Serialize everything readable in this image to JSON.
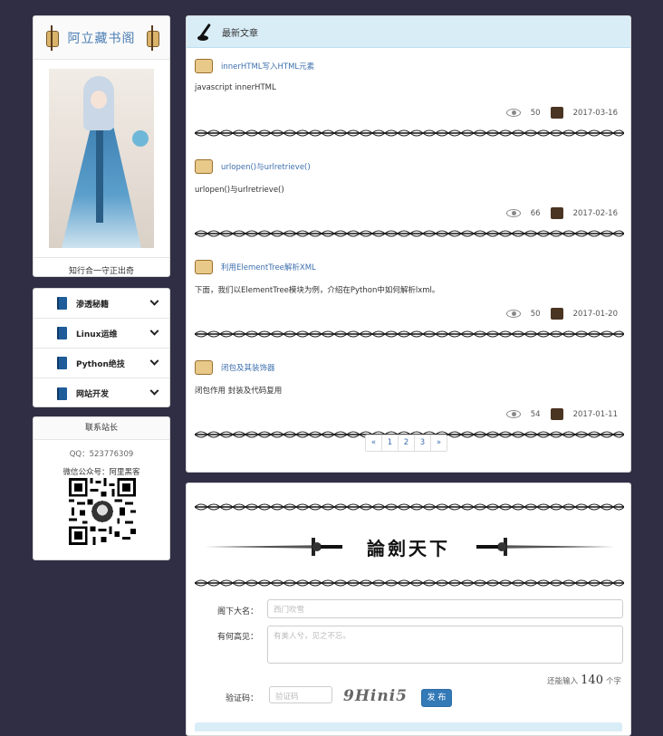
{
  "brand": {
    "title": "阿立藏书阁",
    "motto": "知行合一守正出奇"
  },
  "menu": {
    "items": [
      {
        "label": "渗透秘籍"
      },
      {
        "label": "Linux运维"
      },
      {
        "label": "Python绝技"
      },
      {
        "label": "网站开发"
      }
    ]
  },
  "contact": {
    "title": "联系站长",
    "qq": "QQ：523776309",
    "wechat": "微信公众号：阿里黑客"
  },
  "articles": {
    "title": "最新文章",
    "items": [
      {
        "title": "innerHTML写入HTML元素",
        "summary": "javascript innerHTML",
        "views": "50",
        "date": "2017-03-16"
      },
      {
        "title": "urlopen()与urlretrieve()",
        "summary": "urlopen()与urlretrieve()",
        "views": "66",
        "date": "2017-02-16"
      },
      {
        "title": "利用ElementTree解析XML",
        "summary": "下面，我们以ElementTree模块为例，介绍在Python中如何解析lxml。",
        "views": "50",
        "date": "2017-01-20"
      },
      {
        "title": "闭包及其装饰器",
        "summary": "闭包作用 封装及代码复用",
        "views": "54",
        "date": "2017-01-11"
      }
    ]
  },
  "pagination": {
    "prev": "«",
    "pages": [
      "1",
      "2",
      "3"
    ],
    "next": "»"
  },
  "comment": {
    "banner_title": "論劍天下",
    "name_label": "阁下大名：",
    "name_placeholder": "西门吹雪",
    "opinion_label": "有何高见：",
    "opinion_placeholder": "有美人兮，见之不忘。",
    "counter_prefix": "还能输入",
    "counter_value": "140",
    "counter_suffix": "个字",
    "captcha_label": "验证码：",
    "captcha_placeholder": "验证码",
    "captcha_text": "9Hini5",
    "submit_label": "发 布"
  }
}
